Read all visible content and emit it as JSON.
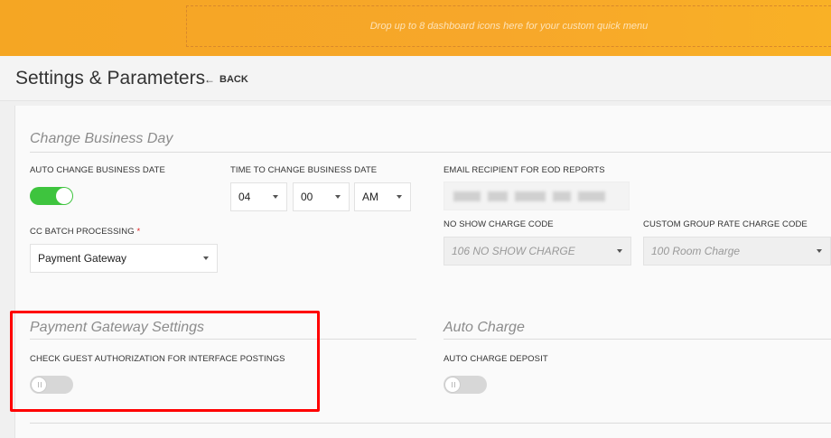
{
  "quick_menu": {
    "placeholder": "Drop up to 8 dashboard icons here for your custom quick menu"
  },
  "header": {
    "title": "Settings & Parameters",
    "back_label": "BACK",
    "back_icon": "arrow-left-icon"
  },
  "business_day": {
    "section_title": "Change Business Day",
    "auto_change_label": "AUTO CHANGE BUSINESS DATE",
    "auto_change_on": true,
    "time_label": "TIME TO CHANGE BUSINESS DATE",
    "hour": "04",
    "minute": "00",
    "ampm": "AM",
    "email_label": "EMAIL RECIPIENT FOR EOD REPORTS",
    "cc_batch_label": "CC BATCH PROCESSING",
    "cc_batch_required": "*",
    "cc_batch_value": "Payment Gateway",
    "no_show_label": "NO SHOW CHARGE CODE",
    "no_show_value": "106 NO SHOW CHARGE",
    "custom_group_label": "CUSTOM GROUP RATE CHARGE CODE",
    "custom_group_value": "100 Room Charge"
  },
  "payment_gateway": {
    "section_title": "Payment Gateway Settings",
    "check_guest_label": "CHECK GUEST AUTHORIZATION FOR INTERFACE POSTINGS",
    "check_guest_on": false
  },
  "auto_charge": {
    "section_title": "Auto Charge",
    "deposit_label": "AUTO CHARGE DEPOSIT",
    "deposit_on": false
  },
  "colors": {
    "accent": "#f5a623",
    "toggle_on": "#3ec43e",
    "highlight": "#ff0000"
  }
}
